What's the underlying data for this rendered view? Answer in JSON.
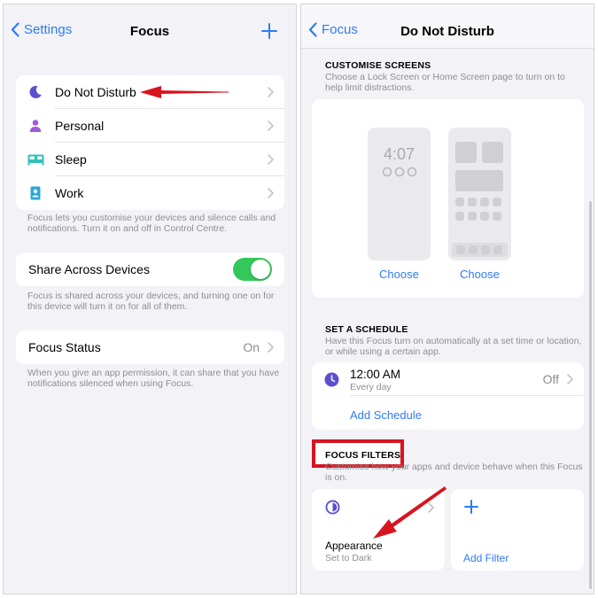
{
  "left": {
    "nav": {
      "back_label": "Settings",
      "title": "Focus"
    },
    "modes": [
      {
        "label": "Do Not Disturb",
        "icon": "moon-icon"
      },
      {
        "label": "Personal",
        "icon": "person-icon"
      },
      {
        "label": "Sleep",
        "icon": "bed-icon"
      },
      {
        "label": "Work",
        "icon": "id-badge-icon"
      }
    ],
    "modes_note": "Focus lets you customise your devices and silence calls and notifications. Turn it on and off in Control Centre.",
    "share": {
      "label": "Share Across Devices",
      "enabled": true
    },
    "share_note": "Focus is shared across your devices, and turning one on for this device will turn it on for all of them.",
    "status": {
      "label": "Focus Status",
      "value": "On"
    },
    "status_note": "When you give an app permission, it can share that you have notifications silenced when using Focus."
  },
  "right": {
    "nav": {
      "back_label": "Focus",
      "title": "Do Not Disturb"
    },
    "customise": {
      "header": "CUSTOMISE SCREENS",
      "subtitle": "Choose a Lock Screen or Home Screen page to turn on to help limit distractions.",
      "lock_time": "4:07",
      "choose_lock": "Choose",
      "choose_home": "Choose"
    },
    "schedule": {
      "header": "SET A SCHEDULE",
      "subtitle": "Have this Focus turn on automatically at a set time or location, or while using a certain app.",
      "item_time": "12:00 AM",
      "item_days": "Every day",
      "item_state": "Off",
      "add_label": "Add Schedule"
    },
    "filters": {
      "header": "FOCUS FILTERS",
      "subtitle": "Customise how your apps and device behave when this Focus is on.",
      "appearance_title": "Appearance",
      "appearance_value": "Set to Dark",
      "add_label": "Add Filter"
    }
  },
  "colors": {
    "accent": "#2f7bf6",
    "highlight": "#d8141f",
    "toggle_on": "#34c759",
    "dnd": "#5b4fcf",
    "personal": "#a05cd6",
    "sleep": "#35c0b7",
    "work": "#2fa7d8"
  }
}
